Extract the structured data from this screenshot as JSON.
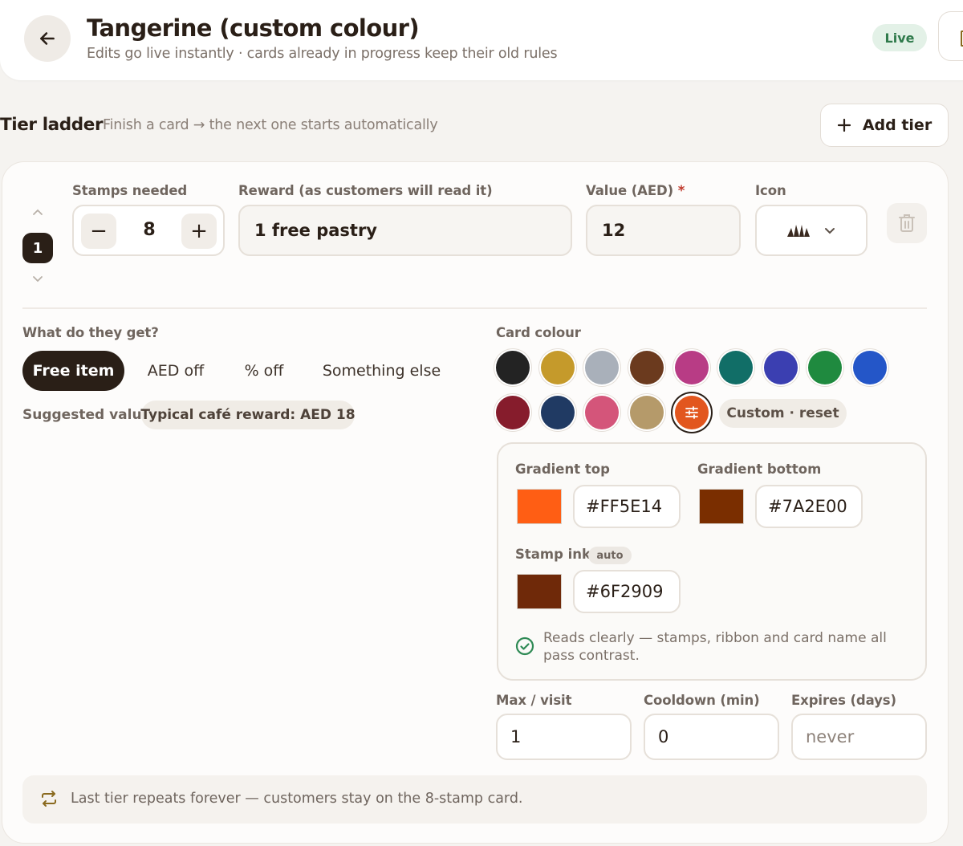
{
  "header": {
    "title": "Tangerine (custom colour)",
    "subtitle": "Edits go live instantly · cards already in progress keep their old rules",
    "status_badge": "Live",
    "back_icon": "arrow-left-icon"
  },
  "tier_ladder": {
    "title": "Tier ladder",
    "hint": "Finish a card → the next one starts automatically",
    "add_tier_label": "Add tier"
  },
  "tier": {
    "number": "1",
    "stamps_label": "Stamps needed",
    "stamps_value": "8",
    "decrement_label": "−",
    "increment_label": "+",
    "reward_label": "Reward (as customers will read it)",
    "reward_value": "1 free pastry",
    "value_label": "Value (AED)",
    "value_required_mark": "*",
    "value_value": "12",
    "icon_label": "Icon",
    "icon_selected": "croissant-icon",
    "reward_type_label": "What do they get?",
    "reward_types": [
      "Free item",
      "AED off",
      "% off",
      "Something else"
    ],
    "reward_type_selected": "Free item",
    "suggested_label": "Suggested value",
    "suggested_value": "Typical café reward: AED 18",
    "card_colour_label": "Card colour",
    "swatches": [
      "#232323",
      "#c59a2b",
      "#a9b0ba",
      "#6b3a1e",
      "#b83c85",
      "#116e67",
      "#3b3fb1",
      "#1f8a3f",
      "#2456c8",
      "#861c2c",
      "#203a63",
      "#d4557a",
      "#b59a6a"
    ],
    "custom_swatch_color": "#e2561e",
    "custom_reset_label": "Custom · reset",
    "gradient_top_label": "Gradient top",
    "gradient_top_hex": "#FF5E14",
    "gradient_bottom_label": "Gradient bottom",
    "gradient_bottom_hex": "#7A2E00",
    "stamp_ink_label": "Stamp ink",
    "stamp_ink_auto": "auto",
    "stamp_ink_hex": "#6F2909",
    "contrast_message": "Reads clearly — stamps, ribbon and card name all pass contrast.",
    "max_visit_label": "Max / visit",
    "max_visit_value": "1",
    "cooldown_label": "Cooldown (min)",
    "cooldown_value": "0",
    "expires_label": "Expires (days)",
    "expires_placeholder": "never"
  },
  "footer": {
    "note": "Last tier repeats forever — customers stay on the 8-stamp card."
  },
  "colors": {
    "accent_dark": "#2a1f17",
    "live_green": "#2f7a4b",
    "check_green": "#2f8a55"
  }
}
